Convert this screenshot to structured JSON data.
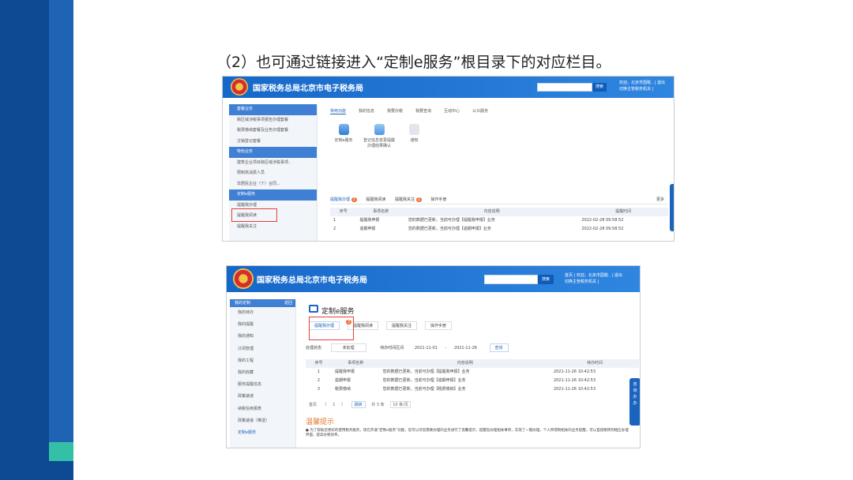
{
  "heading": "（2）也可通过链接进入“定制e服务”根目录下的对应栏目。",
  "common": {
    "brand": "国家税务总局北京市电子税务局",
    "search_button": "搜索"
  },
  "shot1": {
    "user_links": [
      "欢迎，北京市国税..  |  退出",
      "切换主管税务机关  |"
    ],
    "nav_sections": [
      {
        "title": "套餐业务",
        "items": [
          "跨区域涉税事项报告办理套餐",
          "税费缴纳套餐及业务办理套餐",
          "注销登记套餐"
        ]
      },
      {
        "title": "特色业务",
        "items": [
          "建筑企业项目跨区域涉税事项..",
          "限制高消费人员",
          "非居民企业（个）合同..."
        ]
      },
      {
        "title": "定制e服务",
        "items": [
          "提醒我办理",
          "提醒我阅读",
          "提醒我关注"
        ]
      }
    ],
    "tabs": [
      "常用功能",
      "我的信息",
      "我要办税",
      "我要查询",
      "互动中心",
      "公众服务"
    ],
    "tiles": [
      "定制e服务",
      "登记信息变更提醒\n办理结果确认",
      "通知"
    ],
    "sub_tabs": [
      {
        "label": "提醒我办理",
        "count": "2"
      },
      {
        "label": "提醒我阅读",
        "count": ""
      },
      {
        "label": "提醒我关注",
        "count": "2"
      },
      {
        "label": "操作手册",
        "count": ""
      }
    ],
    "more": "更多",
    "columns": [
      "序号",
      "事项名称",
      "内容说明",
      "提醒时间"
    ],
    "rows": [
      {
        "no": "1",
        "name": "提醒我申报",
        "desc": "您的数据已更新，当前可办理【提醒我申报】业务",
        "time": "2022-02-28 09:58:52"
      },
      {
        "no": "2",
        "name": "逾期申报",
        "desc": "您的数据已更新，当前可办理【逾期申报】业务",
        "time": "2022-02-28 09:58:52"
      }
    ]
  },
  "shot2": {
    "user_links": [
      "首页  |  欢迎，北京市国税..  |  退出",
      "切换主管税务机关  |"
    ],
    "nav_header": "我的定制",
    "nav_back": "返回",
    "nav_items": [
      "我的待办",
      "我的提醒",
      "我的通知",
      "订阅管理",
      "我的工程",
      "我的收藏",
      "服务提醒信息",
      "政策速递",
      "纳税信用报表",
      "政策速递（推送）",
      "定制e服务"
    ],
    "page_title": "定制e服务",
    "sub_tabs": [
      "提醒我办理",
      "提醒我阅读",
      "提醒我关注",
      "操作手册"
    ],
    "badge": "3",
    "filters": {
      "status_label": "处理状态",
      "status_value": "未处理",
      "time_label": "待办时间区间",
      "from": "2021-11-01",
      "to_sep": "-",
      "to": "2021-11-26",
      "query": "查询"
    },
    "columns": [
      "序号",
      "事项名称",
      "内容说明",
      "待办时间"
    ],
    "rows": [
      {
        "no": "1",
        "name": "提醒我申报",
        "desc": "您的数据已更新，当前可办理【提醒我申报】业务",
        "time": "2021-11-26 10:42:53"
      },
      {
        "no": "2",
        "name": "逾期申报",
        "desc": "您的数据已更新，当前可办理【逾期申报】业务",
        "time": "2021-11-26 10:42:53"
      },
      {
        "no": "3",
        "name": "税费缴纳",
        "desc": "您的数据已更新，当前可办理【税费缴纳】业务",
        "time": "2021-11-26 10:42:53"
      }
    ],
    "pager": {
      "first": "首页",
      "prev": "〈",
      "page": "1",
      "next": "〉",
      "go": "跳转",
      "total": "共 3 条",
      "size": "10 条/页"
    },
    "tips_title": "温馨提示",
    "tips_text": "● 为了帮助您更好的使用税务服务，现在开通“定制e服务”功能，您可以对您需要办理的业务进行了温馨提示，提醒您办理相关事项，实现了一键办理，个人所得税相关的业务提醒，可以直接跳转到相应办理界面，提高办税效率。",
    "float_tag": "咨询办办"
  }
}
